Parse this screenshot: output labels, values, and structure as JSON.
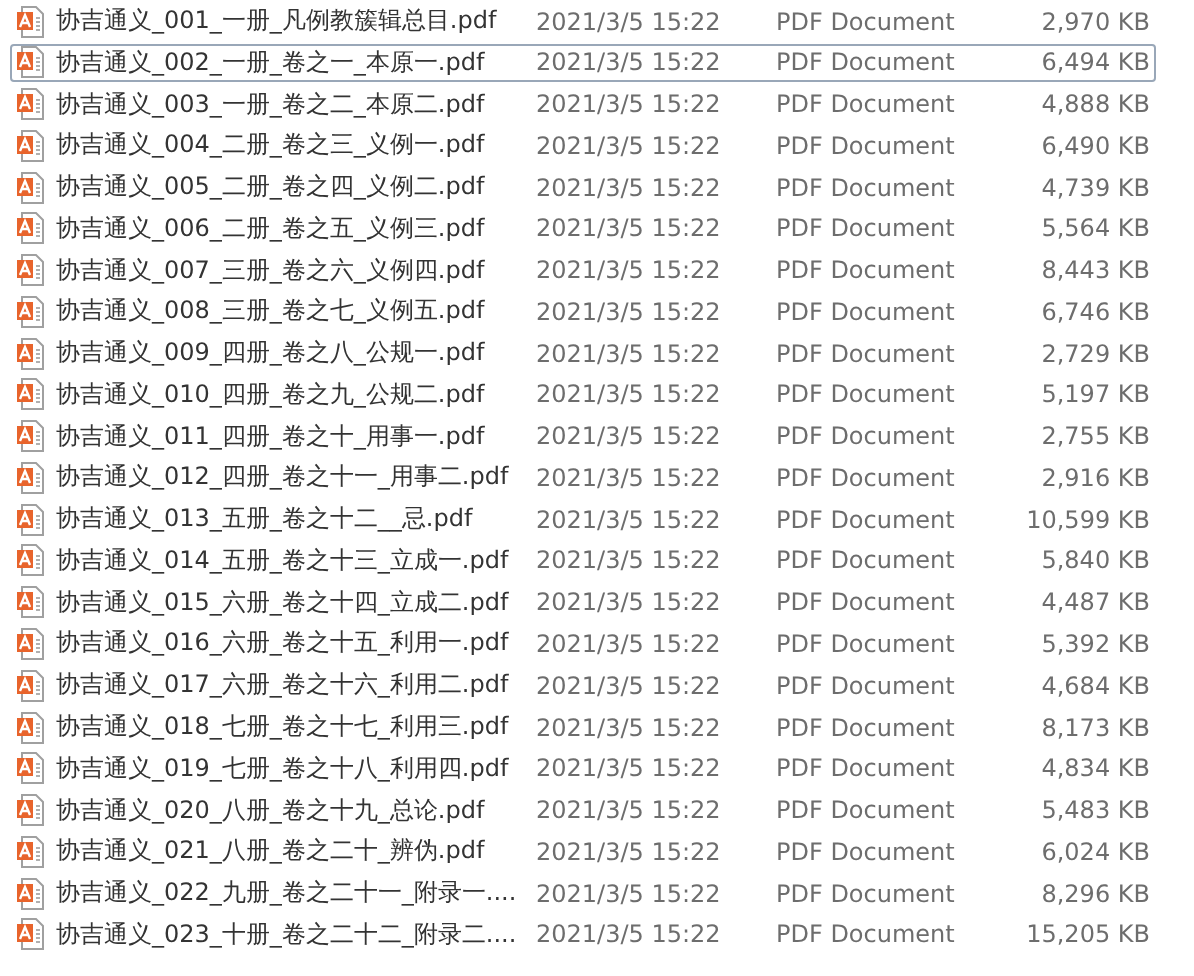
{
  "files": [
    {
      "name": "协吉通义_001_一册_凡例教簇辑总目.pdf",
      "modified": "2021/3/5 15:22",
      "type": "PDF Document",
      "size": "2,970 KB",
      "focused": false
    },
    {
      "name": "协吉通义_002_一册_卷之一_本原一.pdf",
      "modified": "2021/3/5 15:22",
      "type": "PDF Document",
      "size": "6,494 KB",
      "focused": true
    },
    {
      "name": "协吉通义_003_一册_卷之二_本原二.pdf",
      "modified": "2021/3/5 15:22",
      "type": "PDF Document",
      "size": "4,888 KB",
      "focused": false
    },
    {
      "name": "协吉通义_004_二册_卷之三_义例一.pdf",
      "modified": "2021/3/5 15:22",
      "type": "PDF Document",
      "size": "6,490 KB",
      "focused": false
    },
    {
      "name": "协吉通义_005_二册_卷之四_义例二.pdf",
      "modified": "2021/3/5 15:22",
      "type": "PDF Document",
      "size": "4,739 KB",
      "focused": false
    },
    {
      "name": "协吉通义_006_二册_卷之五_义例三.pdf",
      "modified": "2021/3/5 15:22",
      "type": "PDF Document",
      "size": "5,564 KB",
      "focused": false
    },
    {
      "name": "协吉通义_007_三册_卷之六_义例四.pdf",
      "modified": "2021/3/5 15:22",
      "type": "PDF Document",
      "size": "8,443 KB",
      "focused": false
    },
    {
      "name": "协吉通义_008_三册_卷之七_义例五.pdf",
      "modified": "2021/3/5 15:22",
      "type": "PDF Document",
      "size": "6,746 KB",
      "focused": false
    },
    {
      "name": "协吉通义_009_四册_卷之八_公规一.pdf",
      "modified": "2021/3/5 15:22",
      "type": "PDF Document",
      "size": "2,729 KB",
      "focused": false
    },
    {
      "name": "协吉通义_010_四册_卷之九_公规二.pdf",
      "modified": "2021/3/5 15:22",
      "type": "PDF Document",
      "size": "5,197 KB",
      "focused": false
    },
    {
      "name": "协吉通义_011_四册_卷之十_用事一.pdf",
      "modified": "2021/3/5 15:22",
      "type": "PDF Document",
      "size": "2,755 KB",
      "focused": false
    },
    {
      "name": "协吉通义_012_四册_卷之十一_用事二.pdf",
      "modified": "2021/3/5 15:22",
      "type": "PDF Document",
      "size": "2,916 KB",
      "focused": false
    },
    {
      "name": "协吉通义_013_五册_卷之十二__忌.pdf",
      "modified": "2021/3/5 15:22",
      "type": "PDF Document",
      "size": "10,599 KB",
      "focused": false
    },
    {
      "name": "协吉通义_014_五册_卷之十三_立成一.pdf",
      "modified": "2021/3/5 15:22",
      "type": "PDF Document",
      "size": "5,840 KB",
      "focused": false
    },
    {
      "name": "协吉通义_015_六册_卷之十四_立成二.pdf",
      "modified": "2021/3/5 15:22",
      "type": "PDF Document",
      "size": "4,487 KB",
      "focused": false
    },
    {
      "name": "协吉通义_016_六册_卷之十五_利用一.pdf",
      "modified": "2021/3/5 15:22",
      "type": "PDF Document",
      "size": "5,392 KB",
      "focused": false
    },
    {
      "name": "协吉通义_017_六册_卷之十六_利用二.pdf",
      "modified": "2021/3/5 15:22",
      "type": "PDF Document",
      "size": "4,684 KB",
      "focused": false
    },
    {
      "name": "协吉通义_018_七册_卷之十七_利用三.pdf",
      "modified": "2021/3/5 15:22",
      "type": "PDF Document",
      "size": "8,173 KB",
      "focused": false
    },
    {
      "name": "协吉通义_019_七册_卷之十八_利用四.pdf",
      "modified": "2021/3/5 15:22",
      "type": "PDF Document",
      "size": "4,834 KB",
      "focused": false
    },
    {
      "name": "协吉通义_020_八册_卷之十九_总论.pdf",
      "modified": "2021/3/5 15:22",
      "type": "PDF Document",
      "size": "5,483 KB",
      "focused": false
    },
    {
      "name": "协吉通义_021_八册_卷之二十_辨伪.pdf",
      "modified": "2021/3/5 15:22",
      "type": "PDF Document",
      "size": "6,024 KB",
      "focused": false
    },
    {
      "name": "协吉通义_022_九册_卷之二十一_附录一....",
      "modified": "2021/3/5 15:22",
      "type": "PDF Document",
      "size": "8,296 KB",
      "focused": false
    },
    {
      "name": "协吉通义_023_十册_卷之二十二_附录二....",
      "modified": "2021/3/5 15:22",
      "type": "PDF Document",
      "size": "15,205 KB",
      "focused": false
    }
  ]
}
